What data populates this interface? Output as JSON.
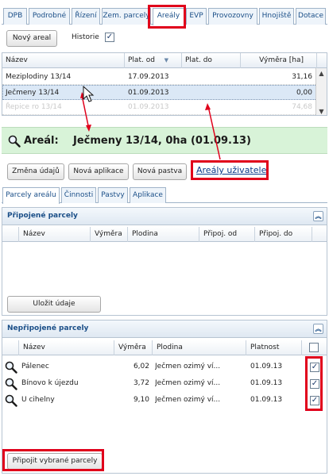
{
  "tabs": [
    "DPB",
    "Podrobné",
    "Řízení",
    "Zem. parcely",
    "Areály",
    "EVP",
    "Provozovny",
    "Hnojiště",
    "Dotace"
  ],
  "toolbar": {
    "new_areal": "Nový areal",
    "history_label": "Historie",
    "history_checked": "✓"
  },
  "areal_grid": {
    "columns": [
      "Název",
      "Plat. od",
      "Plat. do",
      "Výměra [ha]"
    ],
    "rows": [
      {
        "name": "Meziplodiny 13/14",
        "from": "17.09.2013",
        "to": "",
        "area": "31,16"
      },
      {
        "name": "Ječmeny 13/14",
        "from": "01.09.2013",
        "to": "",
        "area": "0,00"
      },
      {
        "name": "Řepice ro 13/14",
        "from": "01.09.2013",
        "to": "",
        "area": "74,68"
      }
    ]
  },
  "areal_header": {
    "label": "Areál:",
    "value": "Ječmeny 13/14, 0ha (01.09.13)"
  },
  "actions": {
    "change_data": "Změna údajů",
    "new_application": "Nová aplikace",
    "new_pasture": "Nová pastva",
    "user_areals_link": "Areály uživatele"
  },
  "subtabs": [
    "Parcely areálu",
    "Činnosti",
    "Pastvy",
    "Aplikace"
  ],
  "attached_panel": {
    "title": "Připojené parcely",
    "columns": [
      "Název",
      "Výměra",
      "Plodina",
      "Připoj. od",
      "Připoj. do"
    ],
    "save_button": "Uložit údaje"
  },
  "detached_panel": {
    "title": "Nepřipojené parcely",
    "columns": [
      "Název",
      "Výměra",
      "Plodina",
      "Platnost"
    ],
    "rows": [
      {
        "name": "Pálenec",
        "area": "6,02",
        "crop": "Ječmen ozimý ví...",
        "validity": "01.09.13",
        "check": "✓"
      },
      {
        "name": "Bínovo k újezdu",
        "area": "3,72",
        "crop": "Ječmen ozimý ví...",
        "validity": "01.09.13",
        "check": "✓"
      },
      {
        "name": "U cihelny",
        "area": "9,10",
        "crop": "Ječmen ozimý ví...",
        "validity": "01.09.13",
        "check": "✓"
      }
    ],
    "attach_button": "Připojit vybrané parcely"
  },
  "icons": {
    "sort": "sort-desc-icon",
    "collapse": "collapse-up-icon",
    "search": "magnifier-icon"
  },
  "colors": {
    "accent": "#1b4f88",
    "highlight_red": "#e0001b",
    "areal_bg": "#d8f3d8",
    "selected_row": "#dbe8f6"
  }
}
